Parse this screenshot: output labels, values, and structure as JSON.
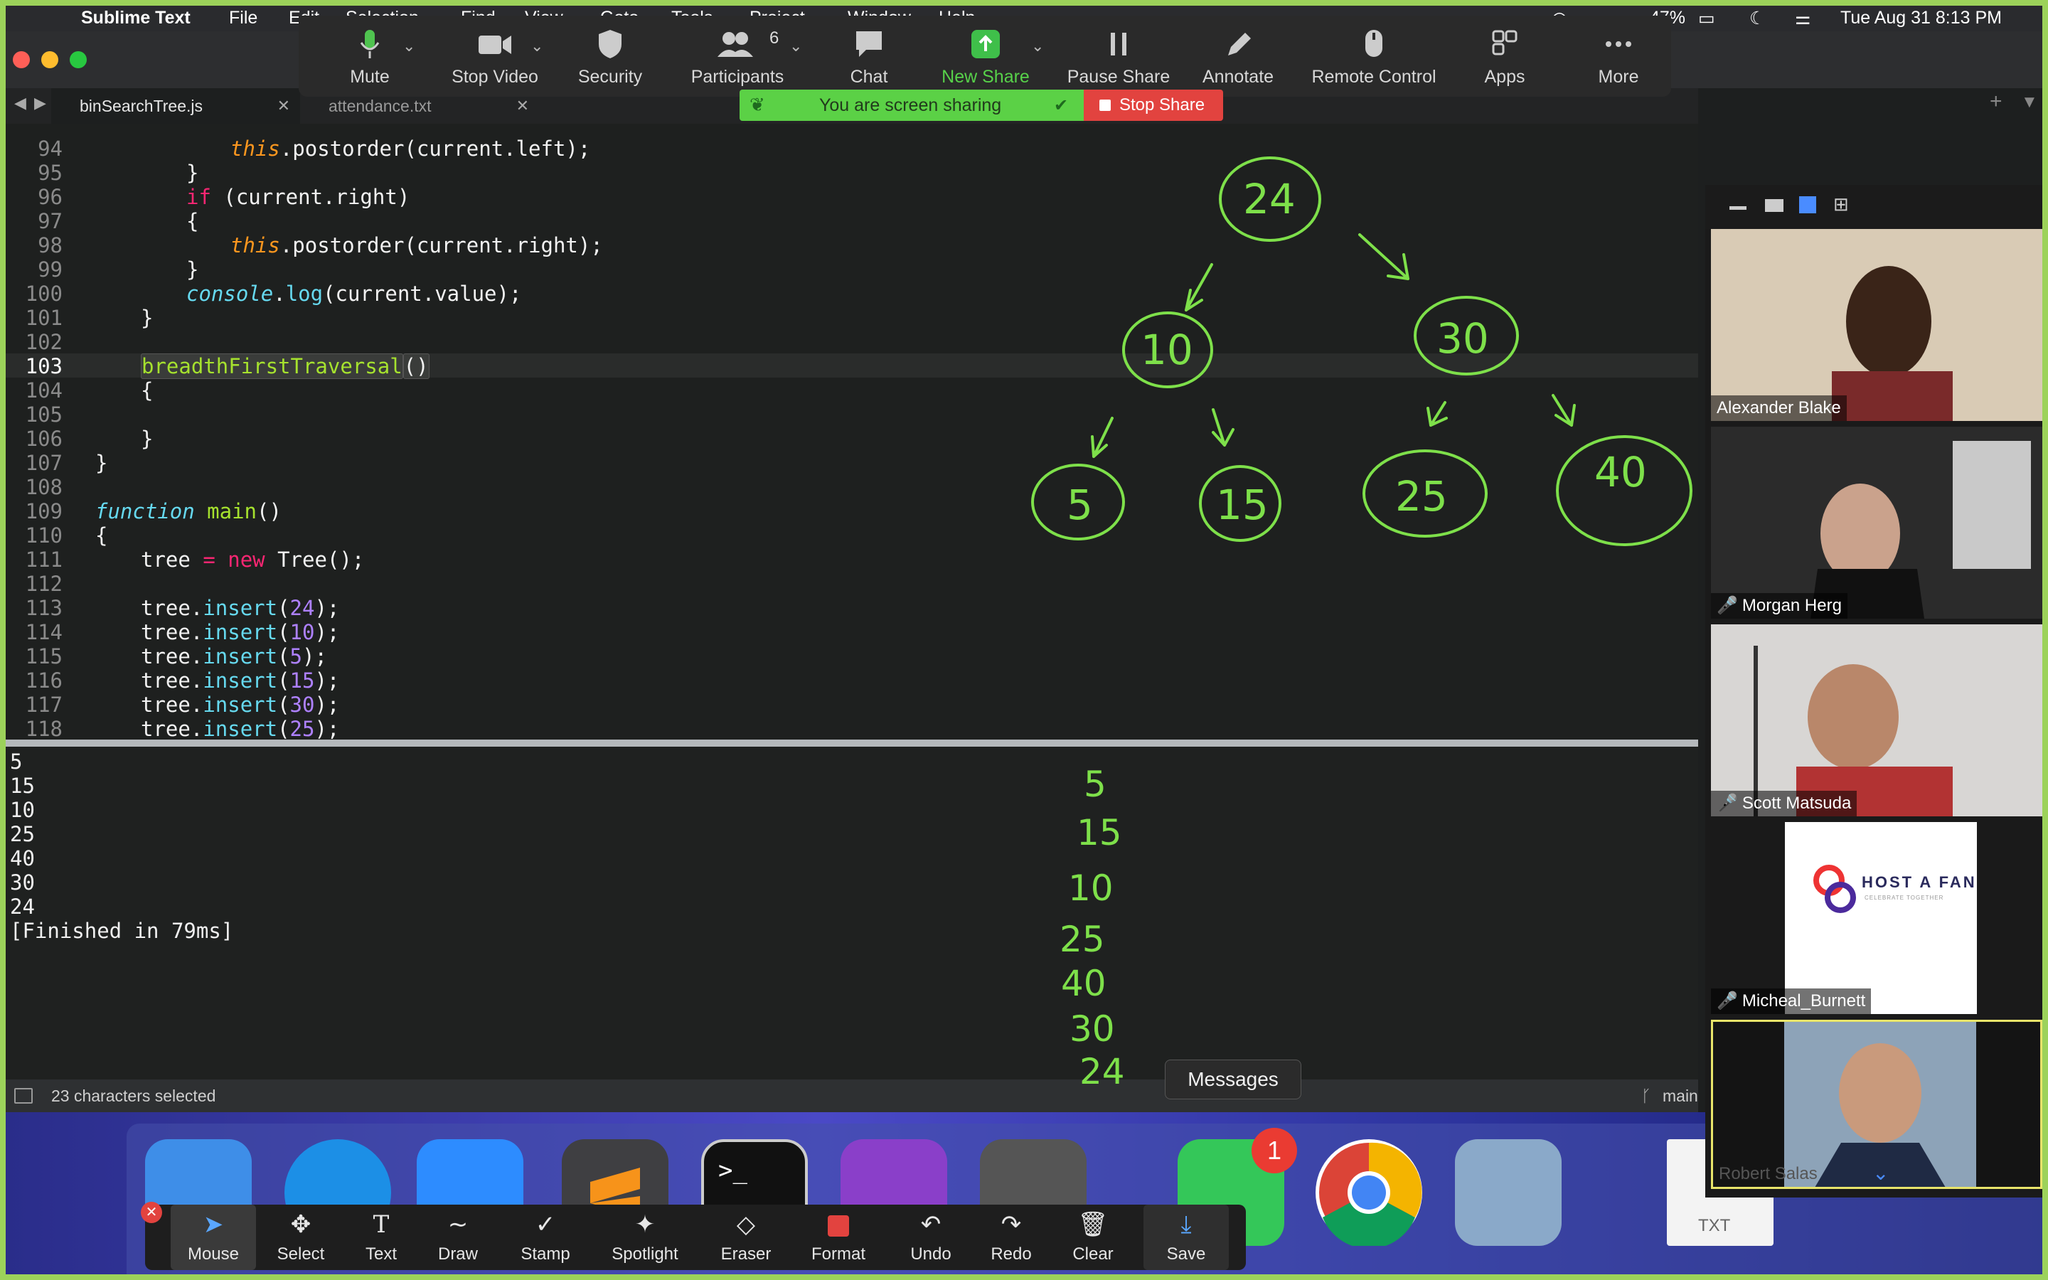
{
  "menubar": {
    "app_name": "Sublime Text",
    "menus": [
      "File",
      "Edit",
      "Selection",
      "Find",
      "View",
      "Goto",
      "Tools",
      "Project",
      "Window",
      "Help"
    ],
    "battery": "47%",
    "datetime": "Tue Aug 31  8:13 PM"
  },
  "tabs": [
    {
      "label": "binSearchTree.js",
      "active": true
    },
    {
      "label": "attendance.txt",
      "active": false
    }
  ],
  "editor": {
    "current_line": 103,
    "lines": [
      {
        "n": "94"
      },
      {
        "n": "95"
      },
      {
        "n": "96"
      },
      {
        "n": "97"
      },
      {
        "n": "98"
      },
      {
        "n": "99"
      },
      {
        "n": "100"
      },
      {
        "n": "101"
      },
      {
        "n": "102"
      },
      {
        "n": "103"
      },
      {
        "n": "104"
      },
      {
        "n": "105"
      },
      {
        "n": "106"
      },
      {
        "n": "107"
      },
      {
        "n": "108"
      },
      {
        "n": "109"
      },
      {
        "n": "110"
      },
      {
        "n": "111"
      },
      {
        "n": "112"
      },
      {
        "n": "113"
      },
      {
        "n": "114"
      },
      {
        "n": "115"
      },
      {
        "n": "116"
      },
      {
        "n": "117"
      },
      {
        "n": "118"
      }
    ],
    "code": {
      "l94": "this.postorder(current.left);",
      "l95": "}",
      "l96_kw": "if",
      "l96": " (current.right)",
      "l97": "{",
      "l98": "this.postorder(current.right);",
      "l99": "}",
      "l100_a": "console",
      "l100_b": ".",
      "l100_c": "log",
      "l100_d": "(current.value);",
      "l101": "}",
      "l103": "breadthFirstTraversal",
      "l103_b": "()",
      "l104": "{",
      "l106": "}",
      "l107": "}",
      "l109_kw": "function",
      "l109_fn": "main",
      "l109_b": "()",
      "l110": "{",
      "l111_a": "tree ",
      "l111_eq": "=",
      "l111_new": "new",
      "l111_b": " Tree();",
      "l113_v": "24",
      "l114_v": "10",
      "l115_v": "5",
      "l116_v": "15",
      "l117_v": "30",
      "l118_v": "25",
      "insert_prefix": "tree.",
      "insert_fn": "insert",
      "open": "(",
      "close": ");",
      "this_kw": "this",
      "postorder": ".postorder"
    }
  },
  "output": {
    "lines": [
      "5",
      "15",
      "10",
      "25",
      "40",
      "30",
      "24",
      "[Finished in 79ms]"
    ]
  },
  "statusbar": {
    "selection": "23 characters selected",
    "branch": "main"
  },
  "zoom_toolbar": {
    "items": [
      {
        "label": "Mute",
        "icon": "microphone-icon"
      },
      {
        "label": "Stop Video",
        "icon": "video-camera-icon"
      },
      {
        "label": "Security",
        "icon": "shield-icon"
      },
      {
        "label": "Participants",
        "icon": "participants-icon",
        "count": "6"
      },
      {
        "label": "Chat",
        "icon": "chat-bubble-icon"
      },
      {
        "label": "New Share",
        "icon": "share-screen-icon"
      },
      {
        "label": "Pause Share",
        "icon": "pause-icon"
      },
      {
        "label": "Annotate",
        "icon": "pencil-icon"
      },
      {
        "label": "Remote Control",
        "icon": "mouse-icon"
      },
      {
        "label": "Apps",
        "icon": "apps-icon"
      },
      {
        "label": "More",
        "icon": "more-dots-icon"
      }
    ],
    "sharing_banner": "You are screen sharing",
    "stop_share": "Stop Share"
  },
  "participants": [
    {
      "name": "Alexander Blake",
      "muted": false
    },
    {
      "name": "Morgan Herg",
      "muted": true
    },
    {
      "name": "Scott Matsuda",
      "muted": true
    },
    {
      "name": "Micheal_Burnett",
      "muted": true
    },
    {
      "name": "Robert Salas",
      "muted": false
    }
  ],
  "host_logo_text": "HOST A FAN",
  "host_logo_tagline": "CELEBRATE TOGETHER",
  "whiteboard": {
    "tree_nodes": [
      "24",
      "10",
      "30",
      "5",
      "15",
      "25",
      "40"
    ],
    "postorder_list": [
      "5",
      "15",
      "10",
      "25",
      "40",
      "30",
      "24"
    ]
  },
  "dock": {
    "tooltip": "Messages",
    "messages_badge": "1",
    "txt_label": "TXT"
  },
  "annotate_toolbar": {
    "items": [
      {
        "label": "Mouse",
        "icon": "cursor-arrow-icon"
      },
      {
        "label": "Select",
        "icon": "move-arrows-icon"
      },
      {
        "label": "Text",
        "icon": "text-T-icon"
      },
      {
        "label": "Draw",
        "icon": "squiggle-icon"
      },
      {
        "label": "Stamp",
        "icon": "checkmark-icon"
      },
      {
        "label": "Spotlight",
        "icon": "magic-wand-icon"
      },
      {
        "label": "Eraser",
        "icon": "eraser-icon"
      },
      {
        "label": "Format",
        "icon": "red-square-icon"
      },
      {
        "label": "Undo",
        "icon": "undo-icon"
      },
      {
        "label": "Redo",
        "icon": "redo-icon"
      },
      {
        "label": "Clear",
        "icon": "trash-icon"
      },
      {
        "label": "Save",
        "icon": "save-download-icon"
      }
    ]
  },
  "colors": {
    "share_border": "#9cd25a",
    "annotation_green": "#7ee04a",
    "stop_red": "#e2433f"
  }
}
